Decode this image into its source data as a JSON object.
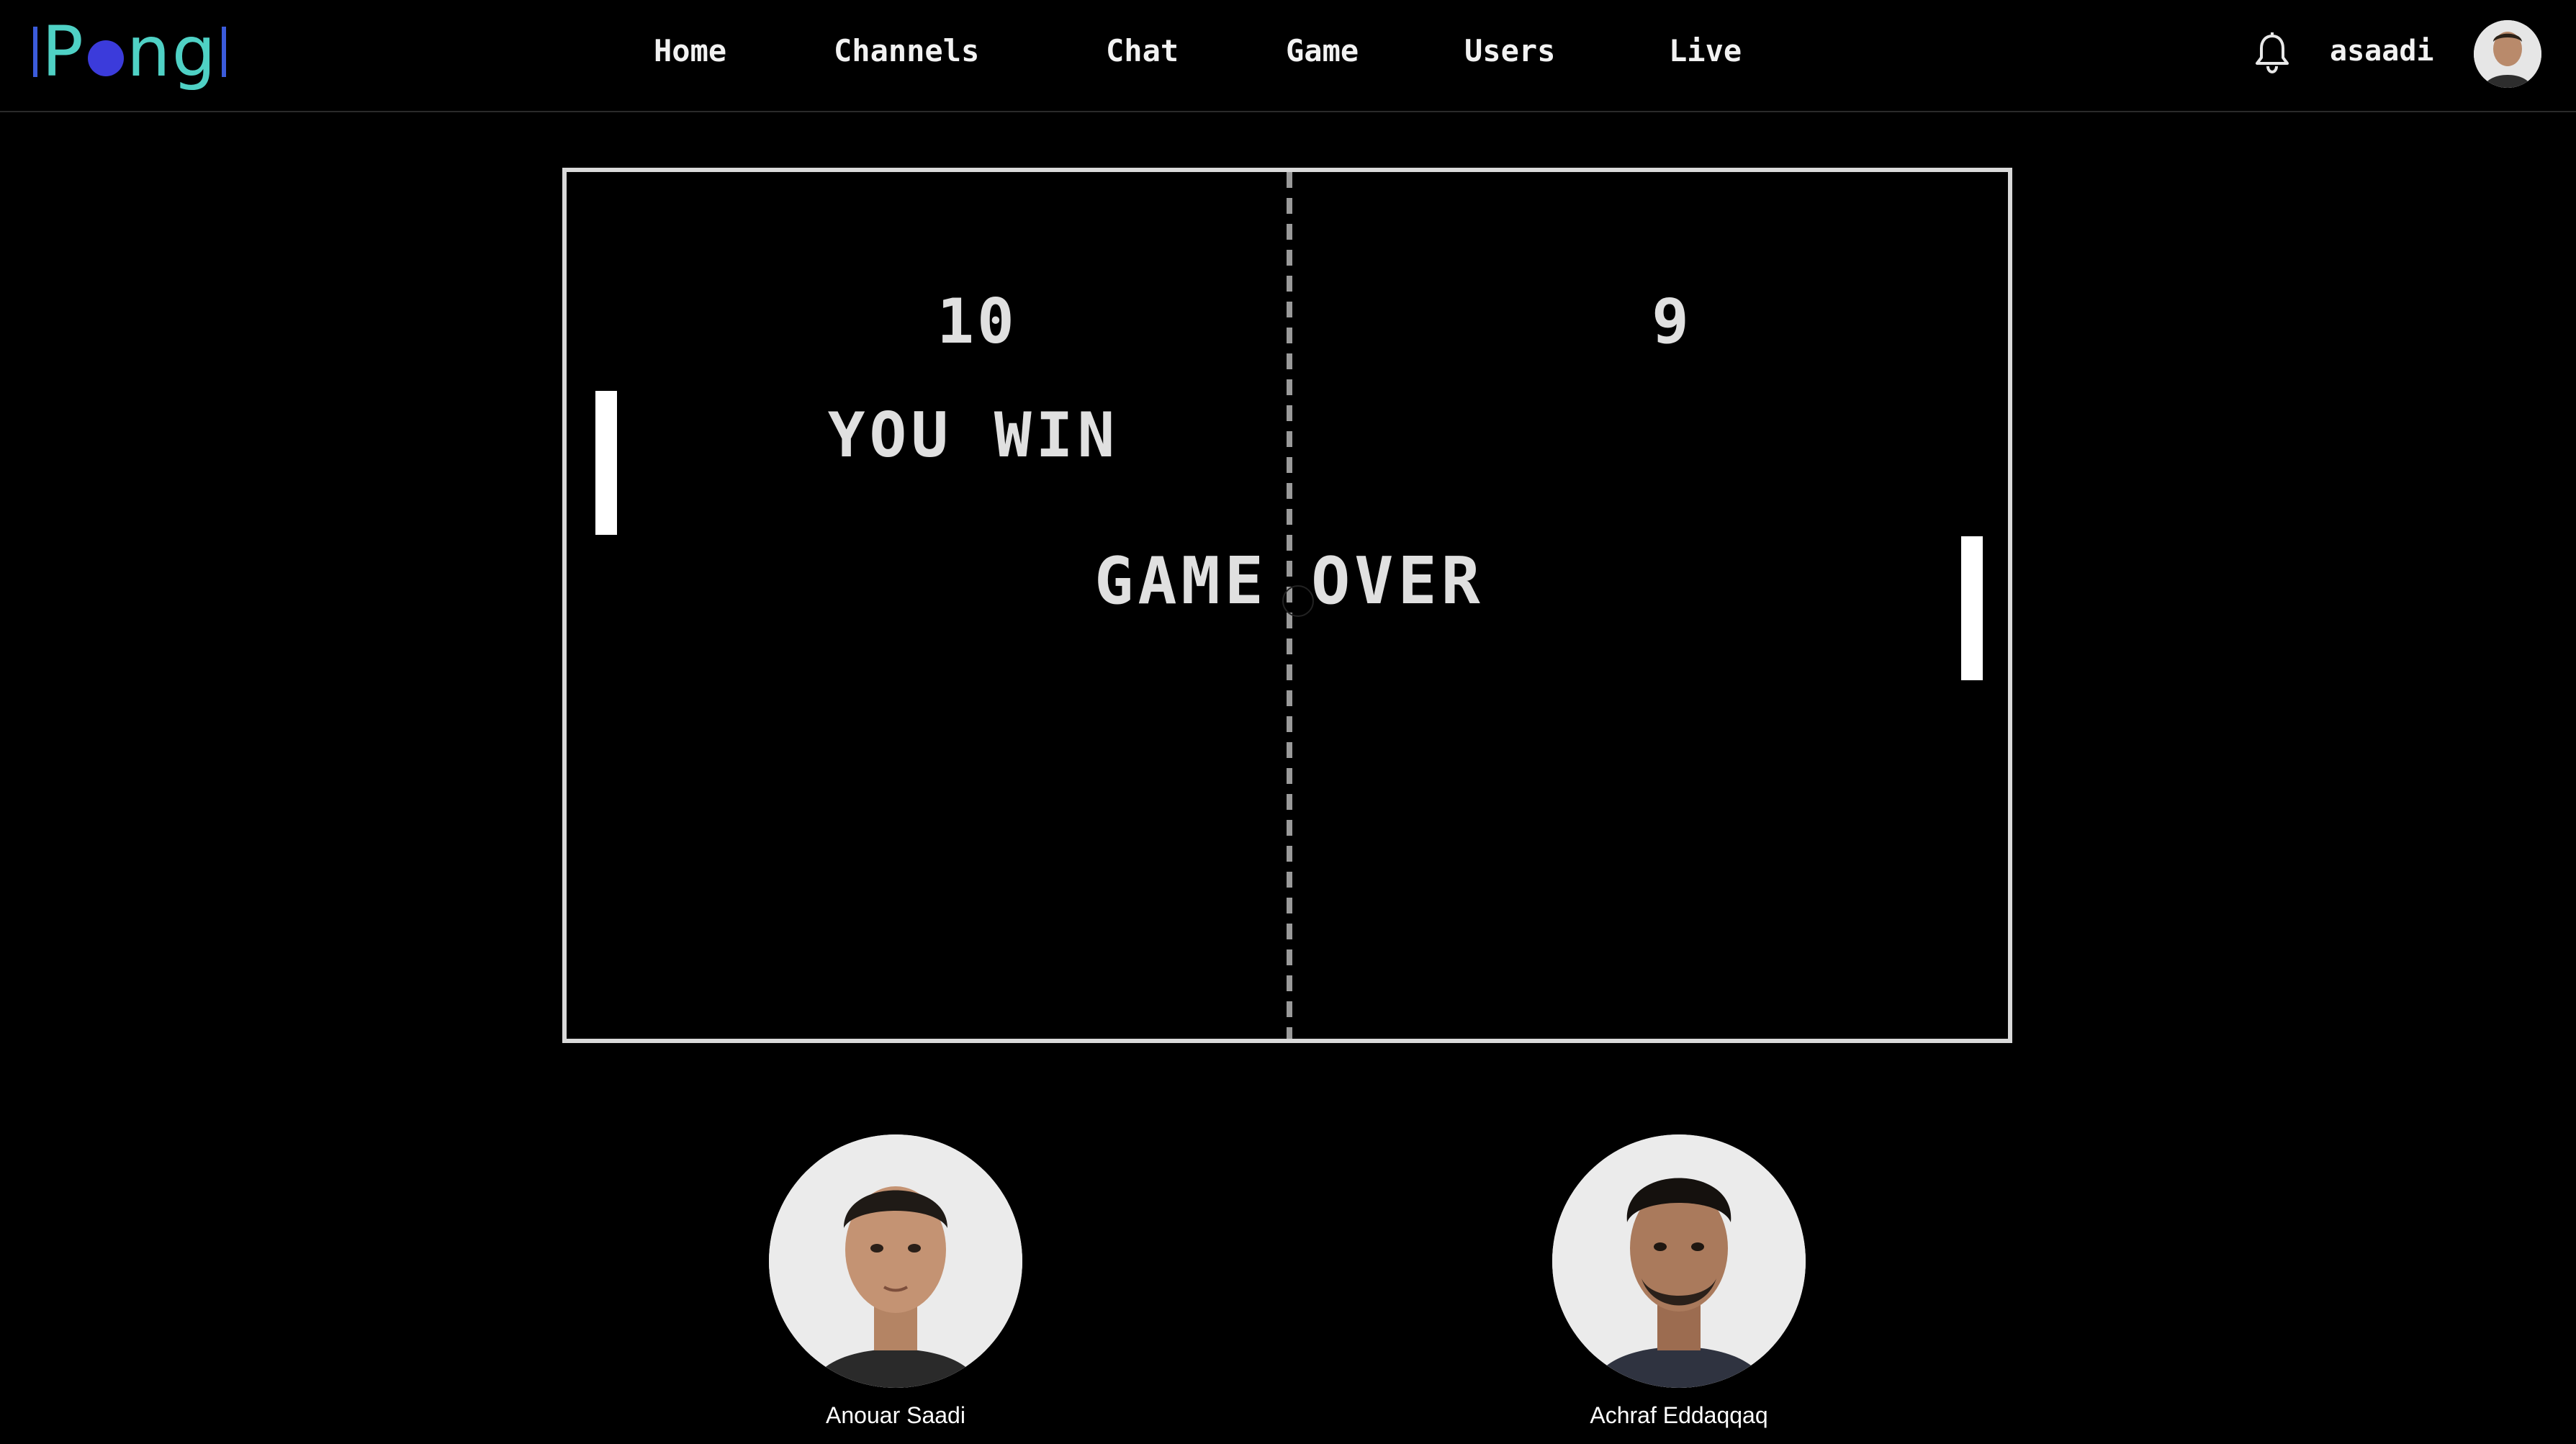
{
  "app": {
    "logo_text": "Pong",
    "logo_color": "#4fd1c5",
    "logo_accent": "#3b3bdb"
  },
  "nav": {
    "items": [
      {
        "label": "Home"
      },
      {
        "label": "Channels"
      },
      {
        "label": "Chat"
      },
      {
        "label": "Game"
      },
      {
        "label": "Users"
      },
      {
        "label": "Live"
      }
    ],
    "notification_icon": "bell-icon",
    "username": "asaadi"
  },
  "game": {
    "left_score": "10",
    "right_score": "9",
    "result_message": "YOU WIN",
    "status_message": "GAME OVER"
  },
  "players": [
    {
      "name": "Anouar Saadi"
    },
    {
      "name": "Achraf Eddaqqaq"
    }
  ]
}
